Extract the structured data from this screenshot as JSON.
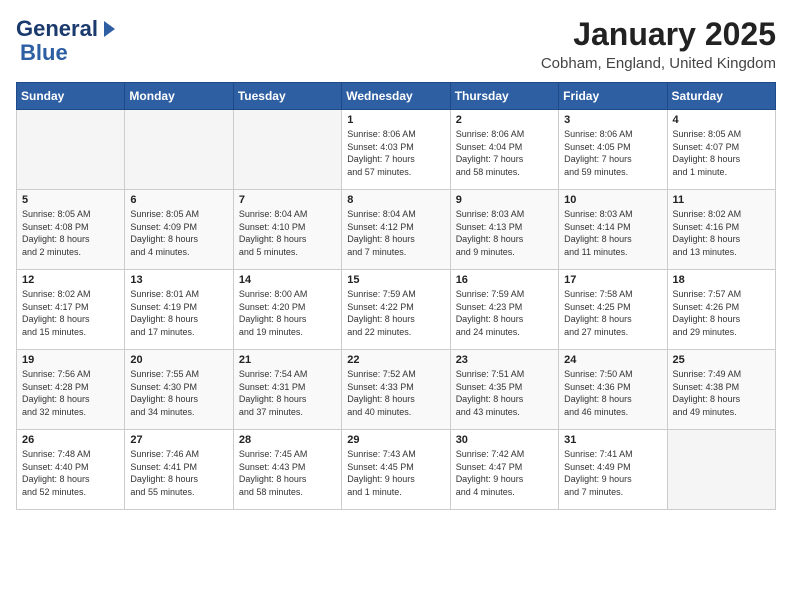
{
  "header": {
    "logo_line1": "General",
    "logo_line2": "Blue",
    "title": "January 2025",
    "subtitle": "Cobham, England, United Kingdom"
  },
  "weekdays": [
    "Sunday",
    "Monday",
    "Tuesday",
    "Wednesday",
    "Thursday",
    "Friday",
    "Saturday"
  ],
  "weeks": [
    [
      {
        "day": "",
        "info": ""
      },
      {
        "day": "",
        "info": ""
      },
      {
        "day": "",
        "info": ""
      },
      {
        "day": "1",
        "info": "Sunrise: 8:06 AM\nSunset: 4:03 PM\nDaylight: 7 hours\nand 57 minutes."
      },
      {
        "day": "2",
        "info": "Sunrise: 8:06 AM\nSunset: 4:04 PM\nDaylight: 7 hours\nand 58 minutes."
      },
      {
        "day": "3",
        "info": "Sunrise: 8:06 AM\nSunset: 4:05 PM\nDaylight: 7 hours\nand 59 minutes."
      },
      {
        "day": "4",
        "info": "Sunrise: 8:05 AM\nSunset: 4:07 PM\nDaylight: 8 hours\nand 1 minute."
      }
    ],
    [
      {
        "day": "5",
        "info": "Sunrise: 8:05 AM\nSunset: 4:08 PM\nDaylight: 8 hours\nand 2 minutes."
      },
      {
        "day": "6",
        "info": "Sunrise: 8:05 AM\nSunset: 4:09 PM\nDaylight: 8 hours\nand 4 minutes."
      },
      {
        "day": "7",
        "info": "Sunrise: 8:04 AM\nSunset: 4:10 PM\nDaylight: 8 hours\nand 5 minutes."
      },
      {
        "day": "8",
        "info": "Sunrise: 8:04 AM\nSunset: 4:12 PM\nDaylight: 8 hours\nand 7 minutes."
      },
      {
        "day": "9",
        "info": "Sunrise: 8:03 AM\nSunset: 4:13 PM\nDaylight: 8 hours\nand 9 minutes."
      },
      {
        "day": "10",
        "info": "Sunrise: 8:03 AM\nSunset: 4:14 PM\nDaylight: 8 hours\nand 11 minutes."
      },
      {
        "day": "11",
        "info": "Sunrise: 8:02 AM\nSunset: 4:16 PM\nDaylight: 8 hours\nand 13 minutes."
      }
    ],
    [
      {
        "day": "12",
        "info": "Sunrise: 8:02 AM\nSunset: 4:17 PM\nDaylight: 8 hours\nand 15 minutes."
      },
      {
        "day": "13",
        "info": "Sunrise: 8:01 AM\nSunset: 4:19 PM\nDaylight: 8 hours\nand 17 minutes."
      },
      {
        "day": "14",
        "info": "Sunrise: 8:00 AM\nSunset: 4:20 PM\nDaylight: 8 hours\nand 19 minutes."
      },
      {
        "day": "15",
        "info": "Sunrise: 7:59 AM\nSunset: 4:22 PM\nDaylight: 8 hours\nand 22 minutes."
      },
      {
        "day": "16",
        "info": "Sunrise: 7:59 AM\nSunset: 4:23 PM\nDaylight: 8 hours\nand 24 minutes."
      },
      {
        "day": "17",
        "info": "Sunrise: 7:58 AM\nSunset: 4:25 PM\nDaylight: 8 hours\nand 27 minutes."
      },
      {
        "day": "18",
        "info": "Sunrise: 7:57 AM\nSunset: 4:26 PM\nDaylight: 8 hours\nand 29 minutes."
      }
    ],
    [
      {
        "day": "19",
        "info": "Sunrise: 7:56 AM\nSunset: 4:28 PM\nDaylight: 8 hours\nand 32 minutes."
      },
      {
        "day": "20",
        "info": "Sunrise: 7:55 AM\nSunset: 4:30 PM\nDaylight: 8 hours\nand 34 minutes."
      },
      {
        "day": "21",
        "info": "Sunrise: 7:54 AM\nSunset: 4:31 PM\nDaylight: 8 hours\nand 37 minutes."
      },
      {
        "day": "22",
        "info": "Sunrise: 7:52 AM\nSunset: 4:33 PM\nDaylight: 8 hours\nand 40 minutes."
      },
      {
        "day": "23",
        "info": "Sunrise: 7:51 AM\nSunset: 4:35 PM\nDaylight: 8 hours\nand 43 minutes."
      },
      {
        "day": "24",
        "info": "Sunrise: 7:50 AM\nSunset: 4:36 PM\nDaylight: 8 hours\nand 46 minutes."
      },
      {
        "day": "25",
        "info": "Sunrise: 7:49 AM\nSunset: 4:38 PM\nDaylight: 8 hours\nand 49 minutes."
      }
    ],
    [
      {
        "day": "26",
        "info": "Sunrise: 7:48 AM\nSunset: 4:40 PM\nDaylight: 8 hours\nand 52 minutes."
      },
      {
        "day": "27",
        "info": "Sunrise: 7:46 AM\nSunset: 4:41 PM\nDaylight: 8 hours\nand 55 minutes."
      },
      {
        "day": "28",
        "info": "Sunrise: 7:45 AM\nSunset: 4:43 PM\nDaylight: 8 hours\nand 58 minutes."
      },
      {
        "day": "29",
        "info": "Sunrise: 7:43 AM\nSunset: 4:45 PM\nDaylight: 9 hours\nand 1 minute."
      },
      {
        "day": "30",
        "info": "Sunrise: 7:42 AM\nSunset: 4:47 PM\nDaylight: 9 hours\nand 4 minutes."
      },
      {
        "day": "31",
        "info": "Sunrise: 7:41 AM\nSunset: 4:49 PM\nDaylight: 9 hours\nand 7 minutes."
      },
      {
        "day": "",
        "info": ""
      }
    ]
  ]
}
